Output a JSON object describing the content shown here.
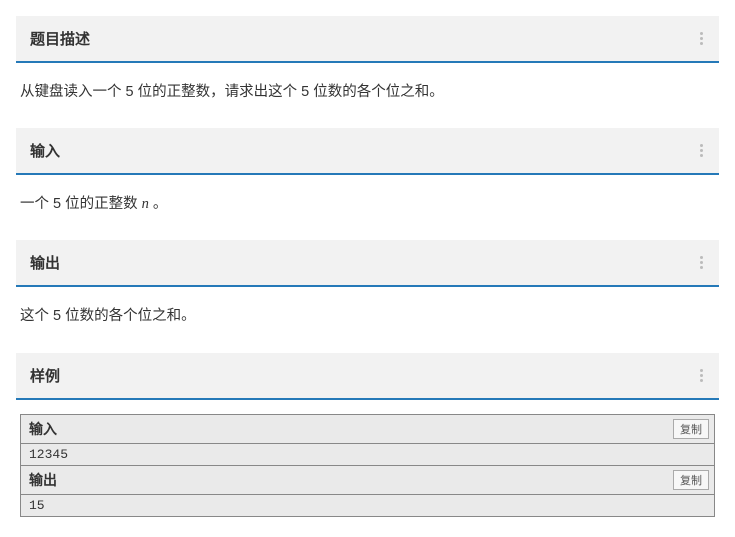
{
  "sections": {
    "desc": {
      "title": "题目描述",
      "body": "从键盘读入一个 5 位的正整数，请求出这个 5 位数的各个位之和。"
    },
    "input": {
      "title": "输入",
      "body_pre": "一个 5 位的正整数 ",
      "body_var": "n",
      "body_post": " 。"
    },
    "output": {
      "title": "输出",
      "body": "这个 5 位数的各个位之和。"
    },
    "sample": {
      "title": "样例"
    }
  },
  "sample": {
    "input_label": "输入",
    "output_label": "输出",
    "copy_label": "复制",
    "input_data": "12345",
    "output_data": "15"
  }
}
